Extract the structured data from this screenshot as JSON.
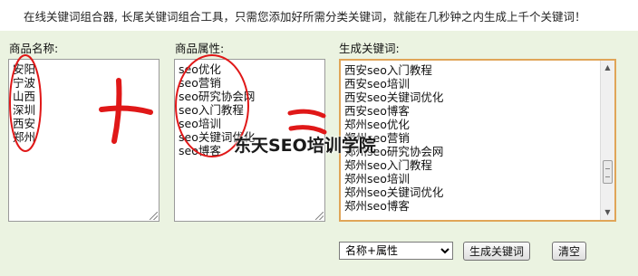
{
  "header": {
    "intro": "在线关键词组合器, 长尾关键词组合工具，只需您添加好所需分类关键词，就能在几秒钟之内生成上千个关键词！"
  },
  "fields": {
    "product_name": {
      "label": "商品名称:",
      "lines": [
        "安阳",
        "宁波",
        "山西",
        "深圳",
        "西安",
        "郑州"
      ]
    },
    "product_attr": {
      "label": "商品属性:",
      "lines": [
        "seo优化",
        "seo营销",
        "seo研究协会网",
        "seo入门教程",
        "seo培训",
        "seo关键词优化",
        "seo博客"
      ]
    },
    "result": {
      "label": "生成关键词:",
      "lines": [
        "西安seo入门教程",
        "西安seo培训",
        "西安seo关键词优化",
        "西安seo博客",
        "郑州seo优化",
        "郑州seo营销",
        "郑州seo研究协会网",
        "郑州seo入门教程",
        "郑州seo培训",
        "郑州seo关键词优化",
        "郑州seo博客"
      ]
    }
  },
  "watermark": "东天SEO培训学院",
  "controls": {
    "mode_selected": "名称+属性",
    "generate_label": "生成关键词",
    "clear_label": "清空"
  },
  "colors": {
    "panel_bg": "#ebf3e1",
    "annotation_red": "#e01818",
    "result_border": "#e0a558"
  },
  "icons": {
    "plus_mark": "plus-annotation",
    "equals_mark": "equals-annotation",
    "select_arrow": "chevron-down-icon",
    "scroll_up": "scroll-up-arrow-icon",
    "scroll_down": "scroll-down-arrow-icon"
  }
}
